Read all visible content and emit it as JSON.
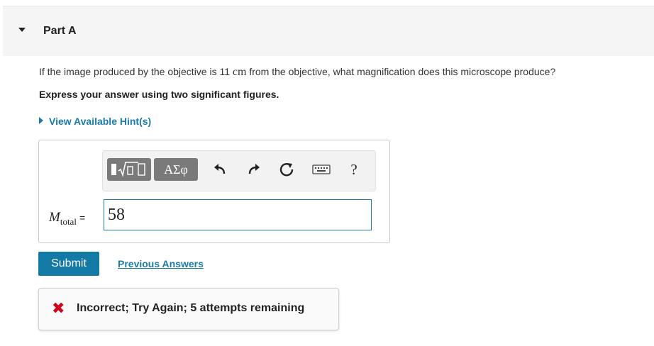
{
  "part": {
    "title": "Part A"
  },
  "question": {
    "prefix": "If the image produced by the objective is 11 ",
    "unit": "cm",
    "suffix": " from the objective, what magnification does this microscope produce?",
    "instruction": "Express your answer using two significant figures."
  },
  "hint": {
    "label": "View Available Hint(s)"
  },
  "toolbar": {
    "greek_label": "ΑΣφ",
    "help_label": "?",
    "icons": [
      "template-icon",
      "undo-icon",
      "redo-icon",
      "reset-icon",
      "keyboard-icon",
      "help-icon"
    ]
  },
  "answer": {
    "var_main": "M",
    "var_sub": "total",
    "equals": "=",
    "value": "58"
  },
  "actions": {
    "submit_label": "Submit",
    "previous_label": "Previous Answers"
  },
  "feedback": {
    "icon": "x-icon",
    "text": "Incorrect; Try Again; 5 attempts remaining",
    "color": "#d0021b"
  },
  "colors": {
    "accent": "#137aa6",
    "link": "#1a7aa8"
  }
}
